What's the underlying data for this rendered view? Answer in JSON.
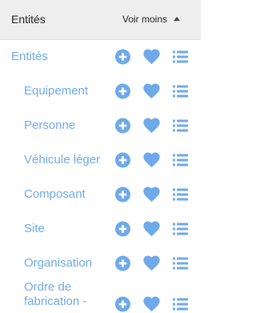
{
  "header": {
    "title": "Entités",
    "toggle_label": "Voir moins"
  },
  "colors": {
    "accent": "#6ea9ea",
    "header_bg": "#eeeeee",
    "text": "#222222"
  },
  "items": [
    {
      "label": "Entités"
    },
    {
      "label": "Equipement"
    },
    {
      "label": "Personne"
    },
    {
      "label": "Véhicule léger"
    },
    {
      "label": "Composant"
    },
    {
      "label": "Site"
    },
    {
      "label": "Organisation"
    },
    {
      "label": "Ordre de fabrication -"
    }
  ],
  "icons": {
    "add": "plus-circle-icon",
    "favorite": "heart-icon",
    "list": "list-icon",
    "collapse": "caret-up-icon"
  }
}
